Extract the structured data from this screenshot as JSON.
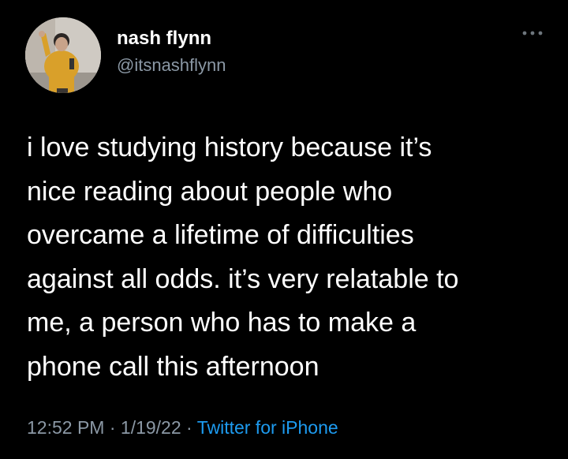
{
  "author": {
    "display_name": "nash flynn",
    "handle": "@itsnashflynn",
    "avatar_icon": "profile-photo-person-yellow-sweater"
  },
  "menu": {
    "more_icon": "more-options-icon"
  },
  "tweet": {
    "lines": [
      "i love studying history because it’s",
      "nice reading about people who",
      "overcame a lifetime of difficulties",
      "against all odds. it’s very relatable to",
      "me, a person who has to make a",
      "phone call this afternoon"
    ]
  },
  "meta": {
    "time": "12:52 PM",
    "separator": " · ",
    "date": "1/19/22",
    "source": "Twitter for iPhone"
  },
  "colors": {
    "background": "#000000",
    "text": "#ffffff",
    "secondary": "#8b98a5",
    "link": "#1d9bf0"
  }
}
